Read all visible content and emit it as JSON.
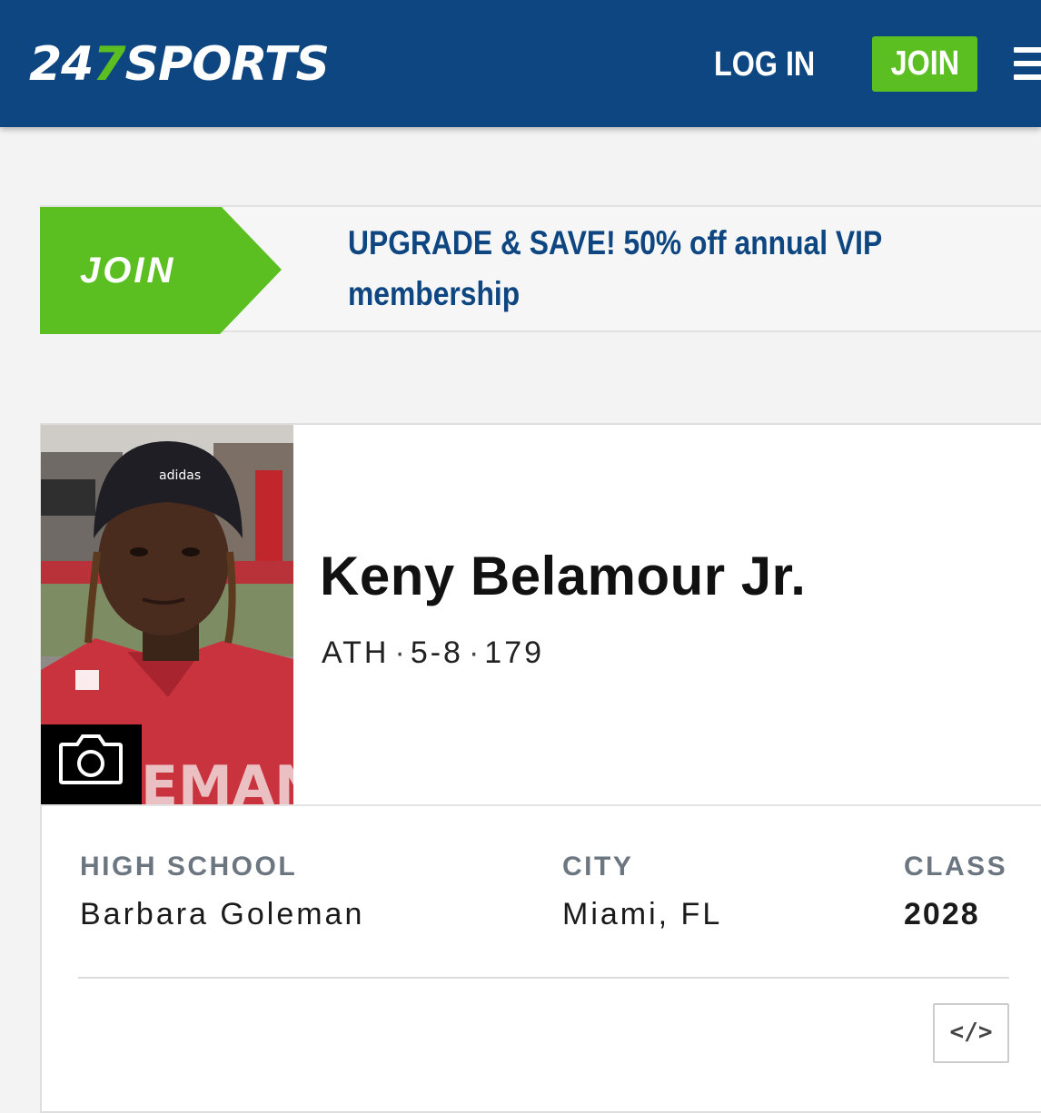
{
  "header": {
    "logo_prefix": "24",
    "logo_seven": "7",
    "logo_suffix": "SPORTS",
    "login_label": "LOG IN",
    "join_label": "JOIN",
    "menu_icon": "hamburger-menu-icon",
    "colors": {
      "bar": "#0e4681",
      "accent": "#5bbf21"
    }
  },
  "promo": {
    "join_label": "JOIN",
    "line1": "UPGRADE & SAVE! 50% off annual VIP",
    "line2": "membership"
  },
  "player": {
    "name": "Keny Belamour Jr.",
    "position": "ATH",
    "height": "5-8",
    "weight": "179",
    "separator": "·",
    "photo_alt": "player-headshot",
    "camera_icon": "camera-icon"
  },
  "info": {
    "high_school_label": "HIGH SCHOOL",
    "high_school_value": "Barbara Goleman",
    "city_label": "CITY",
    "city_value": "Miami, FL",
    "class_label": "CLASS",
    "class_value": "2028"
  },
  "embed": {
    "label": "</>",
    "icon": "embed-code-icon"
  }
}
